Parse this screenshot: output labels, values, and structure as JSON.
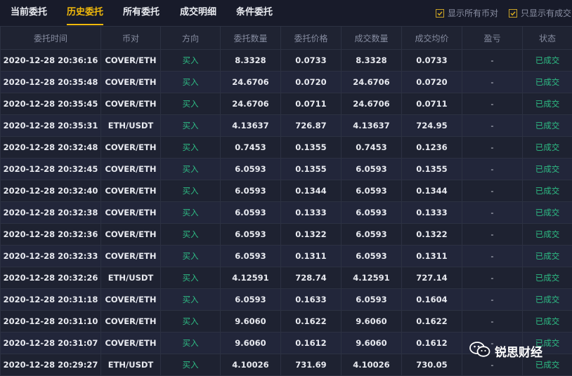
{
  "tabs": [
    {
      "label": "当前委托",
      "active": false
    },
    {
      "label": "历史委托",
      "active": true
    },
    {
      "label": "所有委托",
      "active": false
    },
    {
      "label": "成交明细",
      "active": false
    },
    {
      "label": "条件委托",
      "active": false
    }
  ],
  "options": [
    {
      "label": "显示所有币对",
      "checked": true
    },
    {
      "label": "只显示有成交",
      "checked": true
    }
  ],
  "columns": [
    "委托时间",
    "币对",
    "方向",
    "委托数量",
    "委托价格",
    "成交数量",
    "成交均价",
    "盈亏",
    "状态"
  ],
  "rows": [
    {
      "time": "2020-12-28 20:36:16",
      "pair": "COVER/ETH",
      "side": "买入",
      "qty": "8.3328",
      "price": "0.0733",
      "filled": "8.3328",
      "avg": "0.0733",
      "pnl": "-",
      "status": "已成交"
    },
    {
      "time": "2020-12-28 20:35:48",
      "pair": "COVER/ETH",
      "side": "买入",
      "qty": "24.6706",
      "price": "0.0720",
      "filled": "24.6706",
      "avg": "0.0720",
      "pnl": "-",
      "status": "已成交"
    },
    {
      "time": "2020-12-28 20:35:45",
      "pair": "COVER/ETH",
      "side": "买入",
      "qty": "24.6706",
      "price": "0.0711",
      "filled": "24.6706",
      "avg": "0.0711",
      "pnl": "-",
      "status": "已成交"
    },
    {
      "time": "2020-12-28 20:35:31",
      "pair": "ETH/USDT",
      "side": "买入",
      "qty": "4.13637",
      "price": "726.87",
      "filled": "4.13637",
      "avg": "724.95",
      "pnl": "-",
      "status": "已成交"
    },
    {
      "time": "2020-12-28 20:32:48",
      "pair": "COVER/ETH",
      "side": "买入",
      "qty": "0.7453",
      "price": "0.1355",
      "filled": "0.7453",
      "avg": "0.1236",
      "pnl": "-",
      "status": "已成交"
    },
    {
      "time": "2020-12-28 20:32:45",
      "pair": "COVER/ETH",
      "side": "买入",
      "qty": "6.0593",
      "price": "0.1355",
      "filled": "6.0593",
      "avg": "0.1355",
      "pnl": "-",
      "status": "已成交"
    },
    {
      "time": "2020-12-28 20:32:40",
      "pair": "COVER/ETH",
      "side": "买入",
      "qty": "6.0593",
      "price": "0.1344",
      "filled": "6.0593",
      "avg": "0.1344",
      "pnl": "-",
      "status": "已成交"
    },
    {
      "time": "2020-12-28 20:32:38",
      "pair": "COVER/ETH",
      "side": "买入",
      "qty": "6.0593",
      "price": "0.1333",
      "filled": "6.0593",
      "avg": "0.1333",
      "pnl": "-",
      "status": "已成交"
    },
    {
      "time": "2020-12-28 20:32:36",
      "pair": "COVER/ETH",
      "side": "买入",
      "qty": "6.0593",
      "price": "0.1322",
      "filled": "6.0593",
      "avg": "0.1322",
      "pnl": "-",
      "status": "已成交"
    },
    {
      "time": "2020-12-28 20:32:33",
      "pair": "COVER/ETH",
      "side": "买入",
      "qty": "6.0593",
      "price": "0.1311",
      "filled": "6.0593",
      "avg": "0.1311",
      "pnl": "-",
      "status": "已成交"
    },
    {
      "time": "2020-12-28 20:32:26",
      "pair": "ETH/USDT",
      "side": "买入",
      "qty": "4.12591",
      "price": "728.74",
      "filled": "4.12591",
      "avg": "727.14",
      "pnl": "-",
      "status": "已成交"
    },
    {
      "time": "2020-12-28 20:31:18",
      "pair": "COVER/ETH",
      "side": "买入",
      "qty": "6.0593",
      "price": "0.1633",
      "filled": "6.0593",
      "avg": "0.1604",
      "pnl": "-",
      "status": "已成交"
    },
    {
      "time": "2020-12-28 20:31:10",
      "pair": "COVER/ETH",
      "side": "买入",
      "qty": "9.6060",
      "price": "0.1622",
      "filled": "9.6060",
      "avg": "0.1622",
      "pnl": "-",
      "status": "已成交"
    },
    {
      "time": "2020-12-28 20:31:07",
      "pair": "COVER/ETH",
      "side": "买入",
      "qty": "9.6060",
      "price": "0.1612",
      "filled": "9.6060",
      "avg": "0.1612",
      "pnl": "-",
      "status": "已成交"
    },
    {
      "time": "2020-12-28 20:29:27",
      "pair": "ETH/USDT",
      "side": "买入",
      "qty": "4.10026",
      "price": "731.69",
      "filled": "4.10026",
      "avg": "730.05",
      "pnl": "-",
      "status": "已成交"
    }
  ],
  "watermark": {
    "text": "锐思财经",
    "icon": "wechat-icon"
  },
  "colors": {
    "accent": "#f0b90b",
    "buy": "#2ebd85",
    "background": "#181b2a"
  }
}
